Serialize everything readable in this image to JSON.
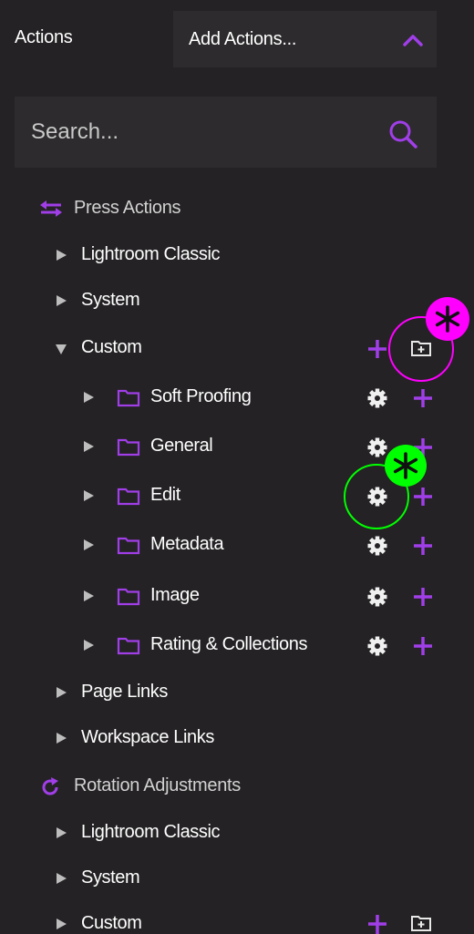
{
  "header": {
    "title": "Actions",
    "dropdown_label": "Add Actions..."
  },
  "search": {
    "placeholder": "Search..."
  },
  "groups": [
    {
      "label": "Press Actions",
      "icon": "swap-arrows-icon",
      "items": [
        {
          "label": "Lightroom Classic",
          "expanded": false
        },
        {
          "label": "System",
          "expanded": false
        },
        {
          "label": "Custom",
          "expanded": true,
          "children": [
            {
              "label": "Soft Proofing"
            },
            {
              "label": "General"
            },
            {
              "label": "Edit"
            },
            {
              "label": "Metadata"
            },
            {
              "label": "Image"
            },
            {
              "label": "Rating & Collections"
            }
          ]
        },
        {
          "label": "Page Links",
          "expanded": false
        },
        {
          "label": "Workspace Links",
          "expanded": false
        }
      ]
    },
    {
      "label": "Rotation Adjustments",
      "icon": "rotate-icon",
      "items": [
        {
          "label": "Lightroom Classic",
          "expanded": false
        },
        {
          "label": "System",
          "expanded": false
        },
        {
          "label": "Custom",
          "expanded": false
        }
      ]
    }
  ],
  "colors": {
    "accent": "#a03ee8",
    "background": "#242224",
    "panel": "#2d2b2d",
    "highlight_magenta": "#ff00ff",
    "highlight_green": "#00ff00"
  }
}
